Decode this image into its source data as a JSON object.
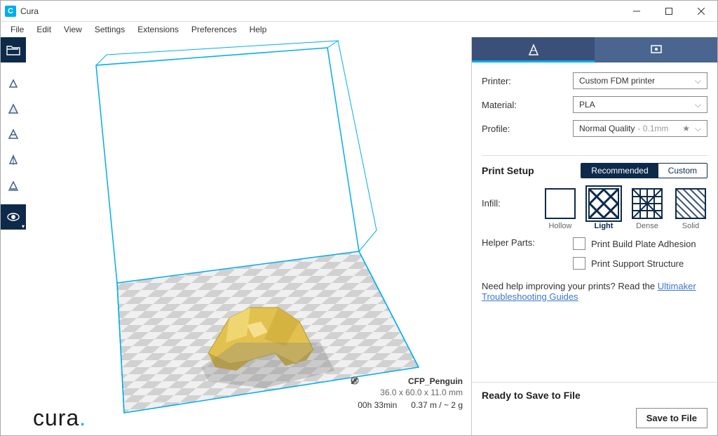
{
  "window": {
    "title": "Cura"
  },
  "menubar": {
    "items": [
      "File",
      "Edit",
      "View",
      "Settings",
      "Extensions",
      "Preferences",
      "Help"
    ]
  },
  "viewport": {
    "model_name": "CFP_Penguin",
    "dimensions": "36.0 x 60.0 x 11.0 mm",
    "time": "00h 33min",
    "filament": "0.37 m / ~ 2 g"
  },
  "panel": {
    "printer_label": "Printer:",
    "printer_value": "Custom FDM printer",
    "material_label": "Material:",
    "material_value": "PLA",
    "profile_label": "Profile:",
    "profile_value": "Normal Quality",
    "profile_detail": " - 0.1mm",
    "print_setup_title": "Print Setup",
    "toggle_recommended": "Recommended",
    "toggle_custom": "Custom",
    "infill_label": "Infill:",
    "infill_options": {
      "hollow": "Hollow",
      "light": "Light",
      "dense": "Dense",
      "solid": "Solid"
    },
    "helper_label": "Helper Parts:",
    "helper_adhesion": "Print Build Plate Adhesion",
    "helper_support": "Print Support Structure",
    "help_prefix": "Need help improving your prints? Read the ",
    "help_link": "Ultimaker Troubleshooting Guides"
  },
  "status": {
    "ready": "Ready to Save to File",
    "save": "Save to File"
  },
  "logo": {
    "text": "cura",
    "dot": "."
  }
}
